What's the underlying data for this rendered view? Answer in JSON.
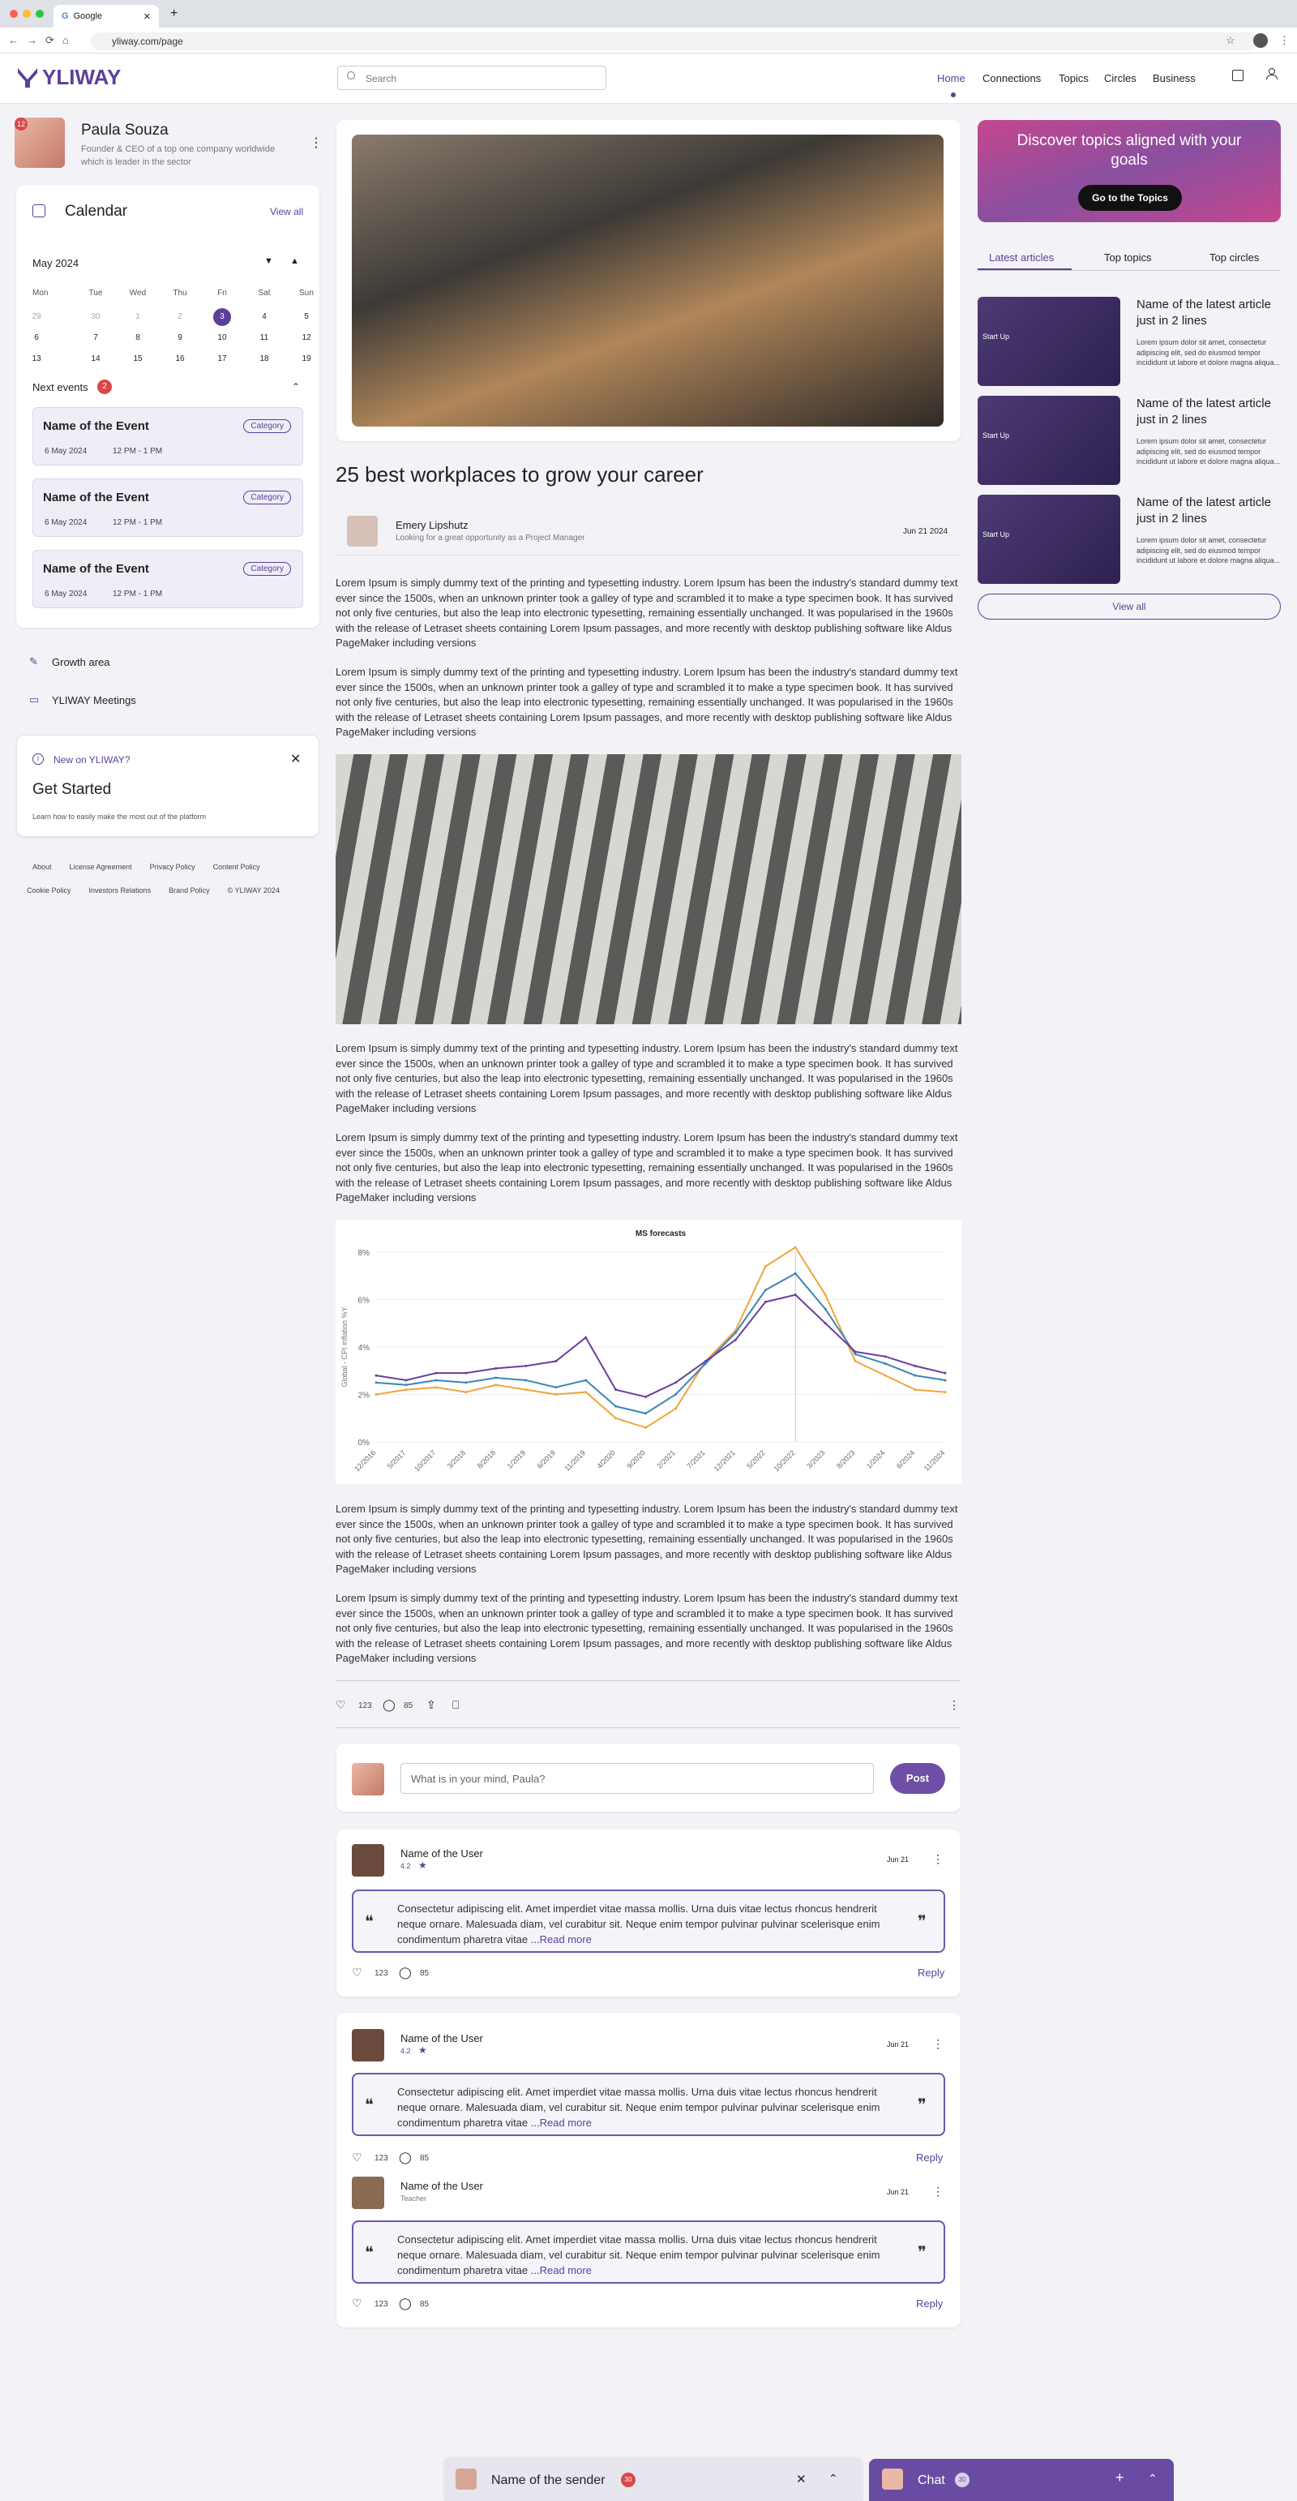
{
  "browser": {
    "tab_title": "Google",
    "url": "yliway.com/page"
  },
  "header": {
    "logo": "YLIWAY",
    "search_placeholder": "Search",
    "nav": [
      "Home",
      "Connections",
      "Topics",
      "Circles",
      "Business"
    ]
  },
  "profile": {
    "name": "Paula Souza",
    "bio": "Founder & CEO of a top one company worldwide which is leader in the sector",
    "badge": "12"
  },
  "calendar": {
    "title": "Calendar",
    "view_all": "View all",
    "month": "May 2024",
    "days": [
      "Mon",
      "Tue",
      "Wed",
      "Thu",
      "Fri",
      "Sat",
      "Sun"
    ],
    "rows": [
      [
        "29",
        "30",
        "1",
        "2",
        "3",
        "4",
        "5"
      ],
      [
        "6",
        "7",
        "8",
        "9",
        "10",
        "11",
        "12"
      ],
      [
        "13",
        "14",
        "15",
        "16",
        "17",
        "18",
        "19"
      ]
    ],
    "next_events_label": "Next events",
    "next_events_count": "2",
    "events": [
      {
        "name": "Name of the Event",
        "category": "Category",
        "date": "6 May 2024",
        "time": "12 PM - 1 PM"
      },
      {
        "name": "Name of the Event",
        "category": "Category",
        "date": "6 May 2024",
        "time": "12 PM - 1 PM"
      },
      {
        "name": "Name of the Event",
        "category": "Category",
        "date": "6 May 2024",
        "time": "12 PM - 1 PM"
      }
    ]
  },
  "sidebar_links": [
    "Growth area",
    "YLIWAY Meetings"
  ],
  "getstarted": {
    "label": "New on YLIWAY?",
    "title": "Get Started",
    "desc": "Learn how to easily make the most out of the platform"
  },
  "footer": {
    "row1": [
      "About",
      "License Agreement",
      "Privacy Policy",
      "Content Policy"
    ],
    "row2": [
      "Cookie Policy",
      "Investors Relations",
      "Brand Policy",
      "© YLIWAY 2024"
    ]
  },
  "article": {
    "title": "25 best workplaces to grow your career",
    "author": "Emery Lipshutz",
    "author_desc": "Looking for a great opportunity as a Project Manager",
    "date": "Jun 21 2024",
    "paragraph": "Lorem Ipsum is simply dummy text of the printing and typesetting industry. Lorem Ipsum has been the industry's standard dummy text ever since the 1500s, when an unknown printer took a galley of type and scrambled it to make a type specimen book. It has survived not only five centuries, but also the leap into electronic typesetting, remaining essentially unchanged. It was popularised in the 1960s with the release of Letraset sheets containing Lorem Ipsum passages, and more recently with desktop publishing software like Aldus PageMaker including versions",
    "likes": "123",
    "comments": "85"
  },
  "chart_data": {
    "type": "line",
    "title": "MS forecasts",
    "ylabel": "Global - CPI inflation %Y",
    "ylim": [
      0,
      8
    ],
    "yticks": [
      "0%",
      "2%",
      "4%",
      "6%",
      "8%"
    ],
    "x": [
      "12/2016",
      "5/2017",
      "10/2017",
      "3/2018",
      "8/2018",
      "1/2019",
      "6/2019",
      "11/2019",
      "4/2020",
      "9/2020",
      "2/2021",
      "7/2021",
      "12/2021",
      "5/2022",
      "10/2022",
      "3/2023",
      "8/2023",
      "1/2024",
      "6/2024",
      "11/2024"
    ],
    "series": [
      {
        "color": "#f0a53a",
        "values": [
          2.0,
          2.2,
          2.3,
          2.1,
          2.4,
          2.2,
          2.0,
          2.1,
          1.0,
          0.6,
          1.4,
          3.4,
          4.7,
          7.4,
          8.2,
          6.2,
          3.4,
          2.8,
          2.2,
          2.1
        ]
      },
      {
        "color": "#3b86b5",
        "values": [
          2.5,
          2.4,
          2.6,
          2.5,
          2.7,
          2.6,
          2.3,
          2.6,
          1.5,
          1.2,
          2.0,
          3.3,
          4.6,
          6.4,
          7.1,
          5.6,
          3.7,
          3.3,
          2.8,
          2.6
        ]
      },
      {
        "color": "#6a3f9a",
        "values": [
          2.8,
          2.6,
          2.9,
          2.9,
          3.1,
          3.2,
          3.4,
          4.4,
          2.2,
          1.9,
          2.5,
          3.4,
          4.3,
          5.9,
          6.2,
          5.0,
          3.8,
          3.6,
          3.2,
          2.9
        ]
      }
    ]
  },
  "composer": {
    "placeholder": "What is in your mind, Paula?",
    "post": "Post"
  },
  "comments": [
    {
      "name": "Name of the User",
      "sub": "4.2",
      "date": "Jun 21",
      "text": "Consectetur adipiscing elit. Amet imperdiet vitae massa mollis. Urna duis vitae lectus rhoncus hendrerit neque ornare. Malesuada diam, vel curabitur sit. Neque enim tempor pulvinar pulvinar scelerisque enim condimentum pharetra vitae ...",
      "more": "Read more",
      "likes": "123",
      "replies": "85",
      "reply": "Reply"
    },
    {
      "name": "Name of the User",
      "sub": "4.2",
      "date": "Jun 21",
      "text": "Consectetur adipiscing elit. Amet imperdiet vitae massa mollis. Urna duis vitae lectus rhoncus hendrerit neque ornare. Malesuada diam, vel curabitur sit. Neque enim tempor pulvinar pulvinar scelerisque enim condimentum pharetra vitae ...",
      "more": "Read more",
      "likes": "123",
      "replies": "85",
      "reply": "Reply"
    },
    {
      "name": "Name of the User",
      "sub": "Teacher",
      "date": "Jun 21",
      "text": "Consectetur adipiscing elit. Amet imperdiet vitae massa mollis. Urna duis vitae lectus rhoncus hendrerit neque ornare. Malesuada diam, vel curabitur sit. Neque enim tempor pulvinar pulvinar scelerisque enim condimentum pharetra vitae ...",
      "more": "Read more",
      "likes": "123",
      "replies": "85",
      "reply": "Reply"
    }
  ],
  "right": {
    "banner_title": "Discover topics aligned with your goals",
    "banner_btn": "Go to the Topics",
    "tabs": [
      "Latest articles",
      "Top topics",
      "Top circles"
    ],
    "articles": [
      {
        "tag": "Start Up",
        "title": "Name of the latest article just in 2 lines",
        "desc": "Lorem ipsum dolor sit amet, consectetur adipiscing elit, sed do eiusmod tempor incididunt ut labore et dolore magna aliqua..."
      },
      {
        "tag": "Start Up",
        "title": "Name of the latest article just in 2 lines",
        "desc": "Lorem ipsum dolor sit amet, consectetur adipiscing elit, sed do eiusmod tempor incididunt ut labore et dolore magna aliqua..."
      },
      {
        "tag": "Start Up",
        "title": "Name of the latest article just in 2 lines",
        "desc": "Lorem ipsum dolor sit amet, consectetur adipiscing elit, sed do eiusmod tempor incididunt ut labore et dolore magna aliqua..."
      }
    ],
    "view_all": "View all"
  },
  "chatbar": {
    "sender": "Name of the sender",
    "sender_count": "30",
    "chat": "Chat",
    "chat_count": "30"
  }
}
